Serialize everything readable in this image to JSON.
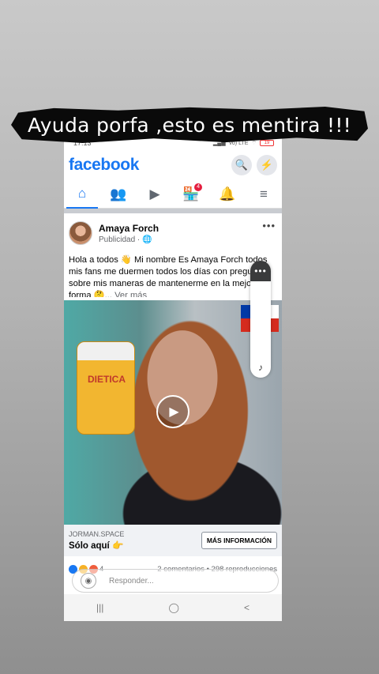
{
  "caption": "Ayuda porfa ,esto es mentira !!!",
  "status_bar": {
    "time": "17:13",
    "carrier": "Vo) LTE",
    "wifi_label": "WiFi",
    "battery": "19"
  },
  "header": {
    "logo": "facebook",
    "search_icon": "search-icon",
    "messenger_icon": "messenger-icon"
  },
  "nav": {
    "items": [
      {
        "name": "home",
        "icon": "home-icon",
        "glyph": "⌂",
        "active": true
      },
      {
        "name": "friends",
        "icon": "friends-icon",
        "glyph": "👥",
        "active": false
      },
      {
        "name": "watch",
        "icon": "video-icon",
        "glyph": "▶",
        "active": false
      },
      {
        "name": "marketplace",
        "icon": "store-icon",
        "glyph": "🏪",
        "active": false,
        "badge": "4"
      },
      {
        "name": "notifications",
        "icon": "bell-icon",
        "glyph": "🔔",
        "active": false
      },
      {
        "name": "menu",
        "icon": "menu-icon",
        "glyph": "≡",
        "active": false
      }
    ]
  },
  "post": {
    "author": "Amaya Forch",
    "sponsored": "Publicidad ·",
    "globe_icon": "🌐",
    "text": "Hola a todos 👋 Mi nombre Es Amaya Forch  todos mis fans me duermen todos los días con preguntas sobre mis maneras de mantenerme en la mejor forma 🤔...",
    "see_more": "Ver más",
    "jar_label": "DIETICA",
    "side_panel_dots": "•••",
    "side_panel_note": "♪"
  },
  "cta": {
    "domain": "JORMAN.SPACE",
    "title": "Sólo aquí 👉",
    "button": "MÁS INFORMACIÓN"
  },
  "stats": {
    "reactions": "4",
    "comments": "2 comentarios",
    "separator": "•",
    "views": "298 reproducciones"
  },
  "reply": {
    "placeholder": "Responder..."
  },
  "system_nav": {
    "recent": "|||",
    "home": "◯",
    "back": "<"
  }
}
